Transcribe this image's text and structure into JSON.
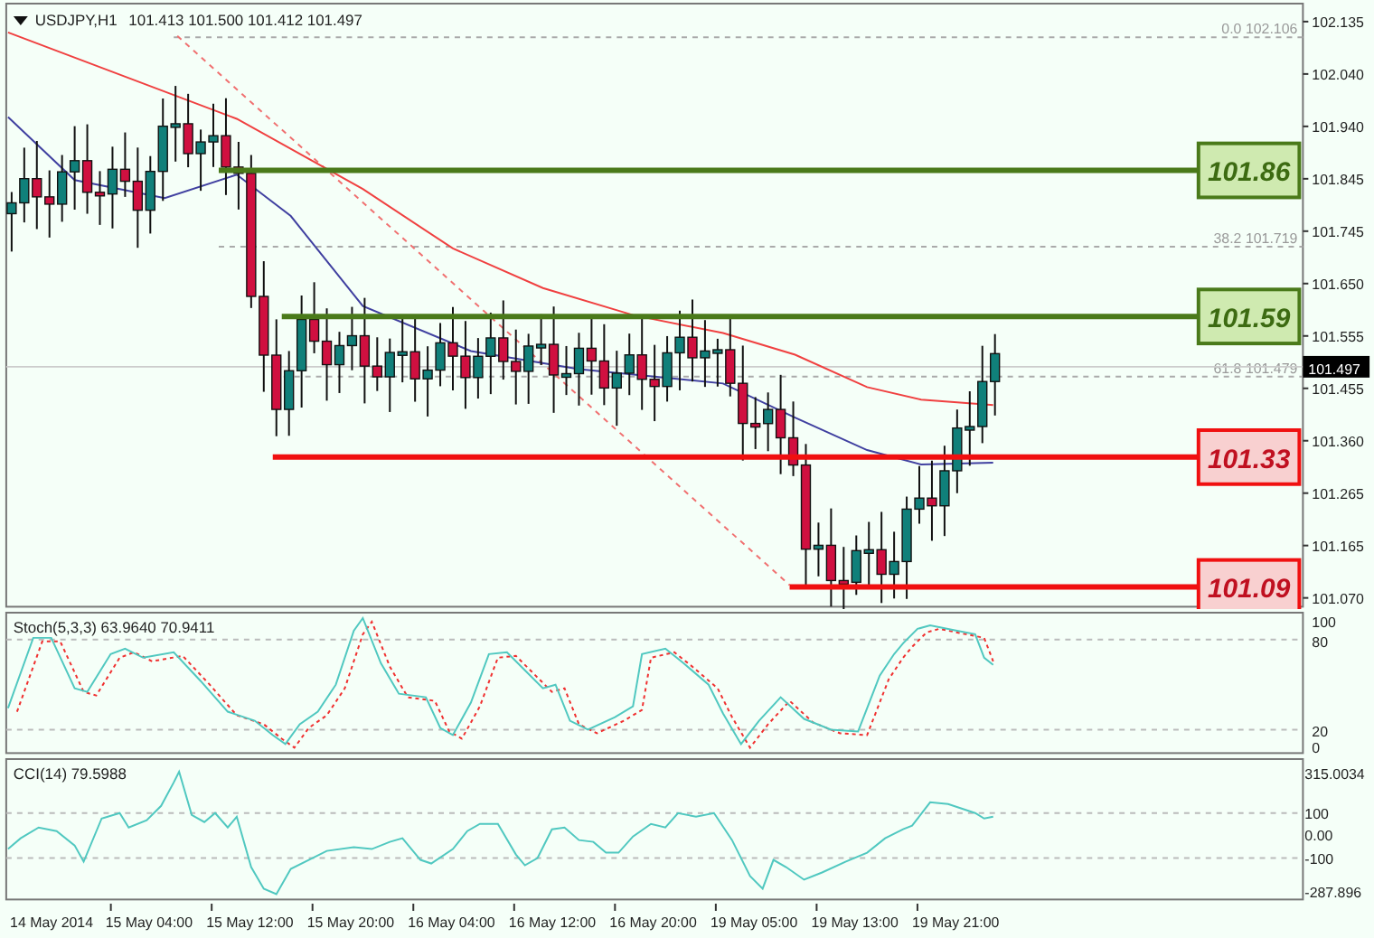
{
  "chart_header": {
    "symbol": "USDJPY,H1",
    "ohlc": "101.413 101.500 101.412 101.497"
  },
  "price_axis": [
    "102.135",
    "102.040",
    "101.940",
    "101.845",
    "101.745",
    "101.650",
    "101.555",
    "101.455",
    "101.360",
    "101.265",
    "101.165",
    "101.070"
  ],
  "current_price": "101.497",
  "fib_levels": [
    "0.0 102.106",
    "38.2 101.719",
    "61.8 101.479"
  ],
  "levels": [
    {
      "label": "101.86",
      "kind": "resistance"
    },
    {
      "label": "101.59",
      "kind": "resistance"
    },
    {
      "label": "101.33",
      "kind": "support"
    },
    {
      "label": "101.09",
      "kind": "support"
    }
  ],
  "stochastic": {
    "title": "Stoch(5,3,3) 63.9640 70.9411",
    "axis": [
      "100",
      "80",
      "20",
      "0"
    ]
  },
  "cci": {
    "title": "CCI(14) 79.5988",
    "axis": [
      "315.0034",
      "100",
      "0.00",
      "-100",
      "-287.896"
    ]
  },
  "time_axis": [
    "14 May 2014",
    "15 May 04:00",
    "15 May 12:00",
    "15 May 20:00",
    "16 May 04:00",
    "16 May 12:00",
    "16 May 20:00",
    "19 May 05:00",
    "19 May 13:00",
    "19 May 21:00"
  ]
}
